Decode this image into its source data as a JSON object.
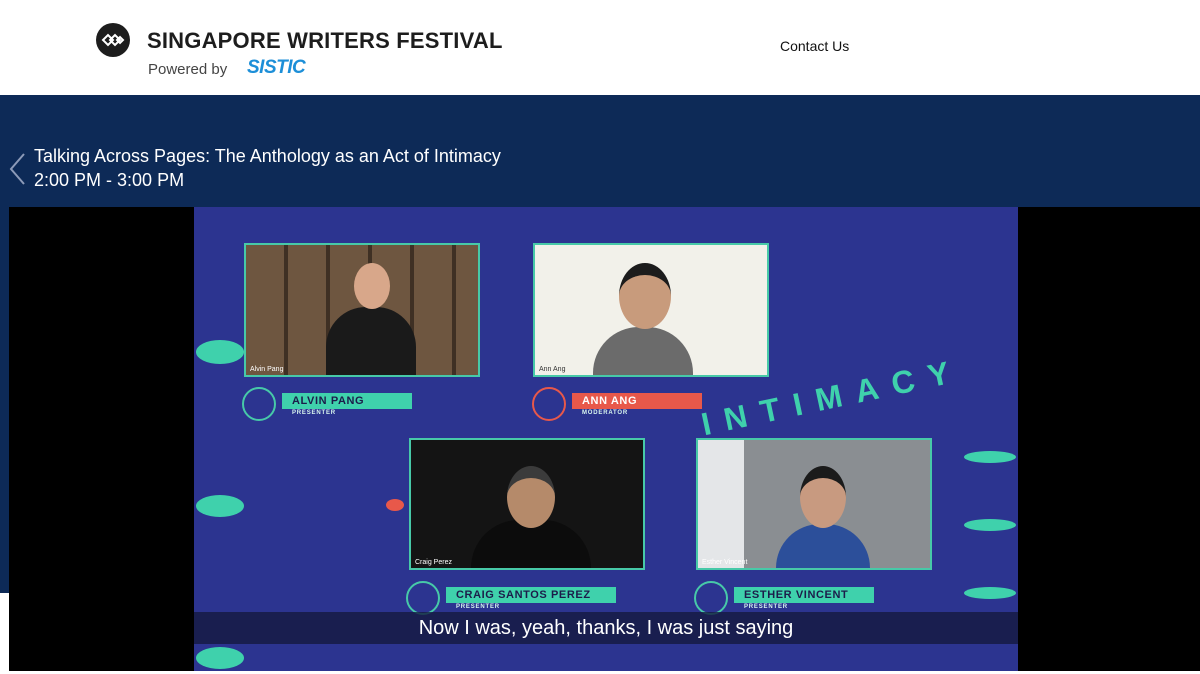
{
  "header": {
    "brand_title": "SINGAPORE WRITERS FESTIVAL",
    "powered_by": "Powered by",
    "powered_brand": "SISTIC",
    "contact_label": "Contact Us"
  },
  "event": {
    "title": "Talking Across Pages: The Anthology as an Act of Intimacy",
    "time": "2:00 PM - 3:00 PM"
  },
  "video": {
    "caption": "Now I was, yeah, thanks, I was just saying",
    "backdrop_word": "INTIMACY",
    "tiles": [
      {
        "label": "Alvin Pang",
        "name": "ALVIN PANG",
        "role": "PRESENTER"
      },
      {
        "label": "Ann Ang",
        "name": "ANN ANG",
        "role": "MODERATOR"
      },
      {
        "label": "Craig Perez",
        "name": "CRAIG SANTOS PEREZ",
        "role": "PRESENTER"
      },
      {
        "label": "Esther Vincent",
        "name": "ESTHER VINCENT",
        "role": "PRESENTER"
      }
    ]
  },
  "colors": {
    "band": "#0d2a57",
    "stage": "#2c3490",
    "accent": "#3fd1ac",
    "moderator": "#e8584a"
  }
}
